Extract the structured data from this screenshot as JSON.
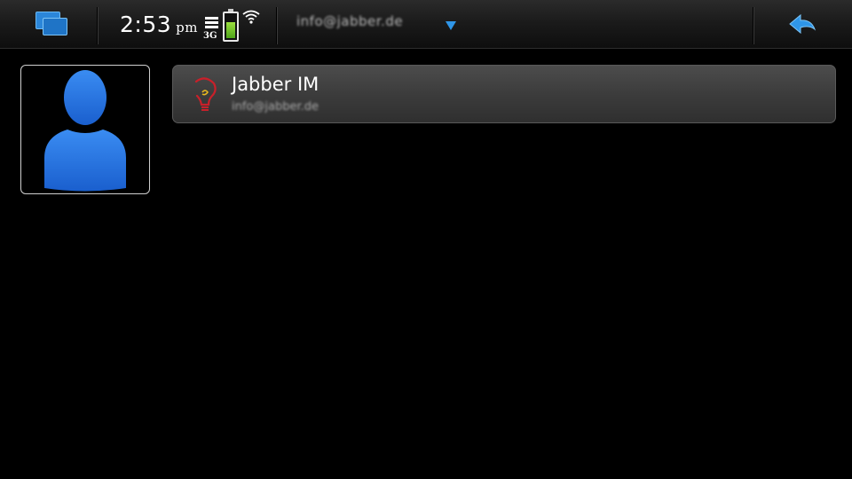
{
  "status_bar": {
    "time": "2:53",
    "ampm": "pm",
    "network": "3G"
  },
  "header": {
    "account_name": "info@jabber.de"
  },
  "icons": {
    "task_switcher": "task-switcher-icon",
    "signal": "signal-strength-icon",
    "battery": "battery-icon",
    "wifi": "wifi-icon",
    "dropdown": "chevron-down-icon",
    "back": "back-arrow-icon",
    "avatar": "user-silhouette-icon",
    "service": "lightbulb-icon"
  },
  "colors": {
    "accent": "#2f96e8",
    "battery": "#7ac22c",
    "service_icon": "#c8202a"
  },
  "accounts": [
    {
      "service": "Jabber IM",
      "id": "info@jabber.de"
    }
  ]
}
